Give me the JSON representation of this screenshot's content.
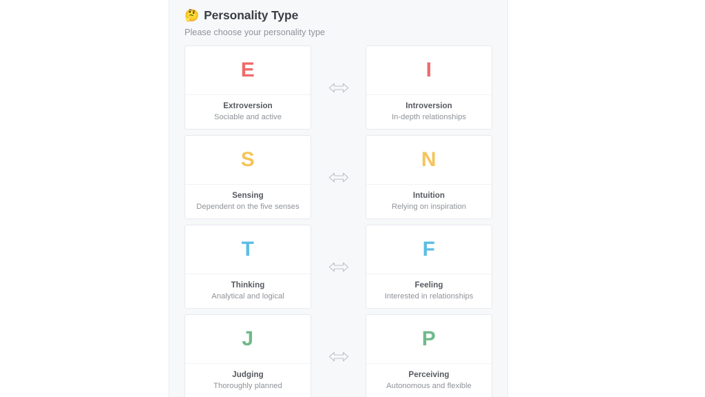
{
  "page": {
    "title": "Personality Type",
    "title_emoji": "🤔",
    "subtitle": "Please choose your personality type",
    "background_color": "#ffffff",
    "panel_color": "#f7f8fa"
  },
  "divider_icon": "left-right-arrow-icon",
  "rows": [
    {
      "left": {
        "letter": "E",
        "color": "#ef6b6b",
        "title": "Extroversion",
        "subtitle": "Sociable and active"
      },
      "right": {
        "letter": "I",
        "color": "#ef6b6b",
        "title": "Introversion",
        "subtitle": "In-depth relationships"
      }
    },
    {
      "left": {
        "letter": "S",
        "color": "#f5c45a",
        "title": "Sensing",
        "subtitle": "Dependent on the five senses"
      },
      "right": {
        "letter": "N",
        "color": "#f5c45a",
        "title": "Intuition",
        "subtitle": "Relying on inspiration"
      }
    },
    {
      "left": {
        "letter": "T",
        "color": "#5bbce4",
        "title": "Thinking",
        "subtitle": "Analytical and logical"
      },
      "right": {
        "letter": "F",
        "color": "#5bbce4",
        "title": "Feeling",
        "subtitle": "Interested in relationships"
      }
    },
    {
      "left": {
        "letter": "J",
        "color": "#6fb98a",
        "title": "Judging",
        "subtitle": "Thoroughly planned"
      },
      "right": {
        "letter": "P",
        "color": "#6fb98a",
        "title": "Perceiving",
        "subtitle": "Autonomous and flexible"
      }
    }
  ]
}
